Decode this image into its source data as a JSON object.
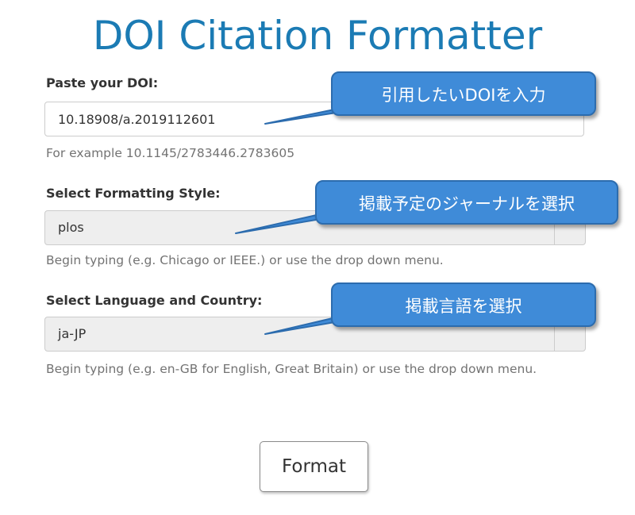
{
  "page": {
    "title": "DOI Citation Formatter"
  },
  "doi": {
    "label": "Paste your DOI:",
    "value": "10.18908/a.2019112601",
    "help": "For example 10.1145/2783446.2783605"
  },
  "style": {
    "label": "Select Formatting Style:",
    "value": "plos",
    "help": "Begin typing (e.g. Chicago or IEEE.) or use the drop down menu."
  },
  "language": {
    "label": "Select Language and Country:",
    "value": "ja-JP",
    "help": "Begin typing (e.g. en-GB for English, Great Britain) or use the drop down menu."
  },
  "button": {
    "format_label": "Format"
  },
  "callouts": {
    "doi": "引用したいDOIを入力",
    "style": "掲載予定のジャーナルを選択",
    "language": "掲載言語を選択"
  },
  "colors": {
    "title": "#1b7bb4",
    "callout_fill": "#3f8bd8",
    "callout_border": "#2c6cae"
  }
}
